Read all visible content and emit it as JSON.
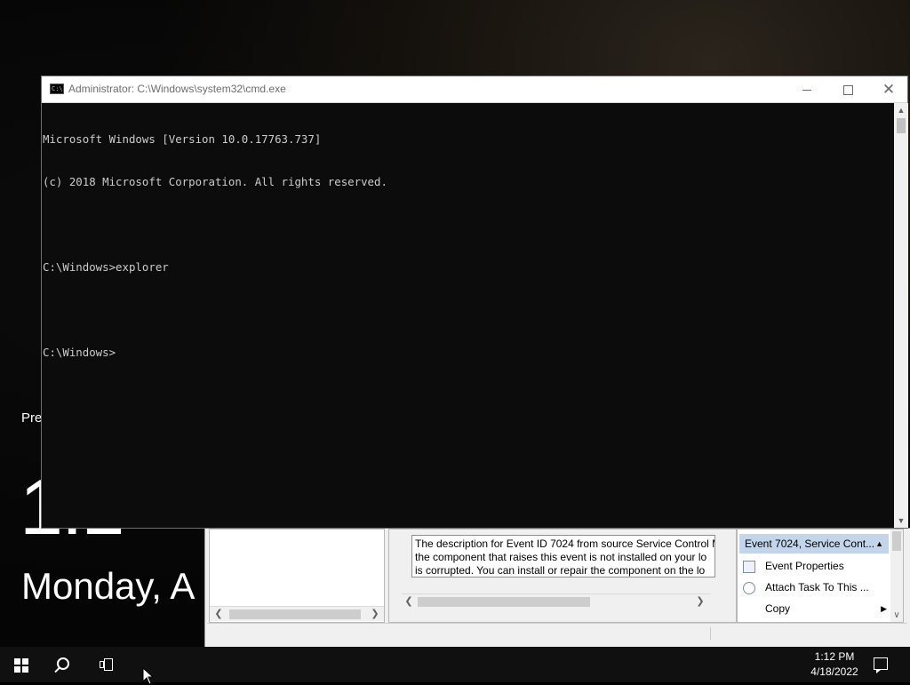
{
  "lock_screen": {
    "press_hint": "Pres",
    "time": "1:1",
    "date": "Monday, A"
  },
  "event_viewer": {
    "description_lines": [
      "The description for Event ID 7024 from source Service Control M",
      "the component that raises this event is not installed on your lo",
      "is corrupted. You can install or repair the component on the lo"
    ],
    "actions": {
      "header": "Event 7024, Service Cont...",
      "items": [
        {
          "label": "Event Properties",
          "icon": "properties-icon"
        },
        {
          "label": "Attach Task To This ...",
          "icon": "clock-icon"
        },
        {
          "label": "Copy",
          "icon": "copy-icon",
          "submenu": true
        }
      ]
    }
  },
  "cmd": {
    "title": "Administrator: C:\\Windows\\system32\\cmd.exe",
    "icon_text": "C:\\",
    "lines": [
      "Microsoft Windows [Version 10.0.17763.737]",
      "(c) 2018 Microsoft Corporation. All rights reserved.",
      "",
      "C:\\Windows>explorer",
      "",
      "C:\\Windows>"
    ]
  },
  "taskbar": {
    "time": "1:12 PM",
    "date": "4/18/2022"
  },
  "colors": {
    "console_bg": "#0c0c0c",
    "console_fg": "#cccccc",
    "taskbar_bg": "#101010",
    "selection_blue": "#c3d5ea"
  }
}
